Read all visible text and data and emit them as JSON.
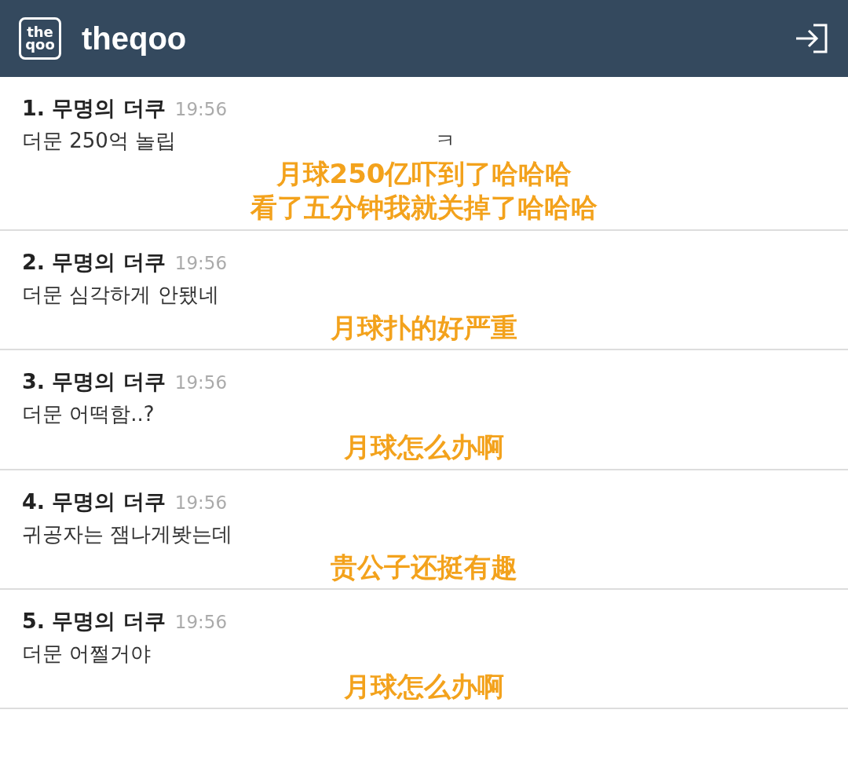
{
  "header": {
    "logo_lines": [
      "the",
      "qoo"
    ],
    "title": "theqoo"
  },
  "comments": [
    {
      "author": "1. 무명의 더쿠",
      "time": "19:56",
      "text": [
        "더문 250억 놀립",
        "ㅋ"
      ],
      "translation": [
        "月球250亿吓到了哈哈哈",
        "看了五分钟我就关掉了哈哈哈"
      ]
    },
    {
      "author": "2. 무명의 더쿠",
      "time": "19:56",
      "text": [
        "더문 심각하게 안됐네"
      ],
      "translation": [
        "月球扑的好严重"
      ]
    },
    {
      "author": "3. 무명의 더쿠",
      "time": "19:56",
      "text": [
        "더문 어떡함..?"
      ],
      "translation": [
        "月球怎么办啊"
      ]
    },
    {
      "author": "4. 무명의 더쿠",
      "time": "19:56",
      "text": [
        "귀공자는 잼나게봣는데"
      ],
      "translation": [
        "贵公子还挺有趣"
      ]
    },
    {
      "author": "5. 무명의 더쿠",
      "time": "19:56",
      "text": [
        "더문 어쩔거야"
      ],
      "translation": [
        "月球怎么办啊"
      ]
    }
  ]
}
